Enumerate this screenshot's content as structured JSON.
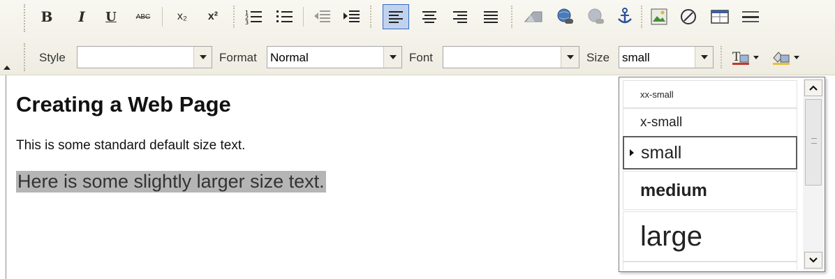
{
  "toolbar": {
    "row1_buttons": [
      {
        "name": "bold-button",
        "label": "B",
        "active": false
      },
      {
        "name": "italic-button",
        "label": "I",
        "active": false
      },
      {
        "name": "underline-button",
        "label": "U",
        "active": false
      },
      {
        "name": "strikethrough-button",
        "label": "ABC",
        "active": false
      },
      {
        "name": "subscript-button",
        "label": "x₂",
        "active": false
      },
      {
        "name": "superscript-button",
        "label": "x²",
        "active": false
      },
      {
        "name": "numbered-list-button",
        "icon": "numbered-list-icon",
        "active": false
      },
      {
        "name": "bulleted-list-button",
        "icon": "bulleted-list-icon",
        "active": false
      },
      {
        "name": "outdent-button",
        "icon": "outdent-icon",
        "active": false
      },
      {
        "name": "indent-button",
        "icon": "indent-icon",
        "active": false
      },
      {
        "name": "align-left-button",
        "icon": "align-left-icon",
        "active": true
      },
      {
        "name": "align-center-button",
        "icon": "align-center-icon",
        "active": false
      },
      {
        "name": "align-right-button",
        "icon": "align-right-icon",
        "active": false
      },
      {
        "name": "justify-button",
        "icon": "justify-icon",
        "active": false
      },
      {
        "name": "insert-flash-button",
        "icon": "flash-icon",
        "active": false
      },
      {
        "name": "insert-link-button",
        "icon": "globe-link-icon",
        "active": false
      },
      {
        "name": "remove-link-button",
        "icon": "unlink-icon",
        "active": false
      },
      {
        "name": "anchor-button",
        "icon": "anchor-icon",
        "active": false
      },
      {
        "name": "insert-image-button",
        "icon": "image-icon",
        "active": false
      },
      {
        "name": "special-char-button",
        "icon": "omega-circle-icon",
        "active": false
      },
      {
        "name": "insert-table-button",
        "icon": "table-icon",
        "active": false
      },
      {
        "name": "horizontal-rule-button",
        "icon": "horizontal-rule-icon",
        "active": false
      }
    ],
    "style_label": "Style",
    "style_value": "",
    "format_label": "Format",
    "format_value": "Normal",
    "font_label": "Font",
    "font_value": "",
    "size_label": "Size",
    "size_value": "small",
    "text_color_icon": "text-color-icon",
    "bg_color_icon": "background-color-icon"
  },
  "editor": {
    "heading": "Creating a Web Page",
    "paragraph_default": "This is some standard default size text.",
    "paragraph_larger": "Here is some slightly larger size text."
  },
  "size_dropdown": {
    "options": [
      {
        "label": "xx-small",
        "selected": false
      },
      {
        "label": "x-small",
        "selected": false
      },
      {
        "label": "small",
        "selected": true
      },
      {
        "label": "medium",
        "selected": false
      },
      {
        "label": "large",
        "selected": false
      }
    ]
  },
  "colors": {
    "toolbar_bg": "#f3f1e8",
    "active_button_bg": "#c1d2ee",
    "active_button_border": "#316ac5",
    "highlight_bg": "#b5b5b5"
  }
}
